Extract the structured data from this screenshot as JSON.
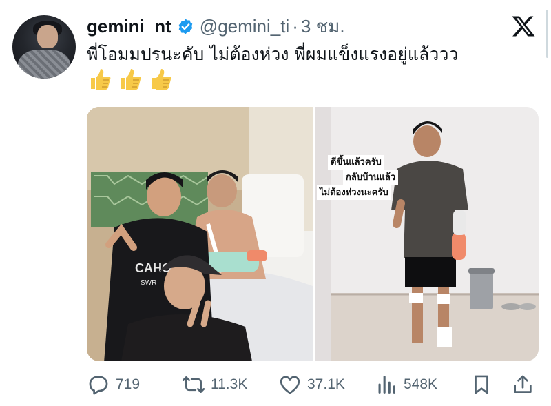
{
  "user": {
    "display_name": "gemini_nt",
    "handle": "@gemini_ti",
    "separator": "·",
    "time": "3 ชม.",
    "verified": true,
    "avatar_icon": "avatar-photo"
  },
  "tweet": {
    "text": "พี่โอมมปรนะคับ ไม่ต้องห่วง พี่ผมแข็งแรงอยู่แล้ววว",
    "emojis": [
      "thumbs-up-icon",
      "thumbs-up-icon",
      "thumbs-up-icon"
    ]
  },
  "media": {
    "left_photo": "hospital-selfie-photo",
    "right_photo": "standing-recovery-photo",
    "overlay_lines": [
      "ดีขึ้นแล้วครับ",
      "กลับบ้านแล้ว",
      "ไม่ต้องห่วงนะครับ"
    ],
    "jersey_text": "CAHO",
    "jersey_sub": "SWR"
  },
  "actions": {
    "reply_count": "719",
    "retweet_count": "11.3K",
    "like_count": "37.1K",
    "views_count": "548K"
  },
  "colors": {
    "text_primary": "#0f1419",
    "text_secondary": "#536471",
    "verified_blue": "#1d9bf0",
    "thumb_yellow": "#f7c948"
  }
}
